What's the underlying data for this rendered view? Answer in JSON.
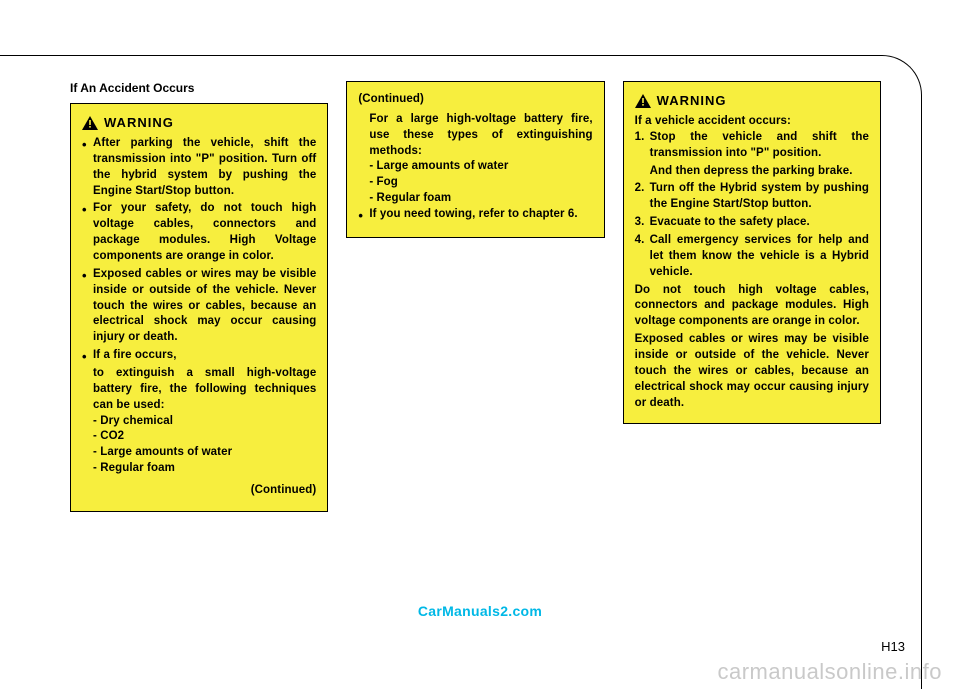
{
  "section_heading": "If An Accident Occurs",
  "warning_label": "WARNING",
  "col1": {
    "bullets": [
      "After parking the vehicle, shift the transmission into \"P\" position. Turn off the hybrid system by pushing the Engine Start/Stop button.",
      "For your safety, do not touch high voltage cables, connectors and package modules. High Voltage components are orange in color.",
      "Exposed cables or wires may be visible inside or outside of the vehicle. Never touch the wires or cables, because an electrical shock may occur causing injury or death.",
      "If a fire occurs,"
    ],
    "fire_text": "to extinguish a small high-voltage battery fire, the following techniques can be used:",
    "methods": [
      "- Dry chemical",
      "- CO2",
      "- Large amounts of water",
      "- Regular foam"
    ],
    "continued": "(Continued)"
  },
  "col2": {
    "continued": "(Continued)",
    "intro": "For a large high-voltage battery fire, use these types of extinguishing methods:",
    "methods": [
      "- Large amounts of water",
      "- Fog",
      "- Regular foam"
    ],
    "towing": "If you need towing, refer to chapter 6."
  },
  "col3": {
    "intro": "If a vehicle accident occurs:",
    "steps": [
      {
        "num": "1.",
        "text": "Stop the vehicle and shift the transmission into \"P\" position.",
        "extra": "And then depress the parking brake."
      },
      {
        "num": "2.",
        "text": "Turn off the Hybrid system by pushing the Engine Start/Stop button."
      },
      {
        "num": "3.",
        "text": "Evacuate to the safety place."
      },
      {
        "num": "4.",
        "text": "Call emergency services for help and let them know the vehicle is a Hybrid vehicle."
      }
    ],
    "para1": "Do not touch high voltage cables, connectors and package modules. High voltage components are orange in color.",
    "para2": "Exposed cables or wires may be visible inside or outside of the vehicle. Never touch the wires or cables, because an electrical shock may occur causing injury or death."
  },
  "watermark1": "CarManuals2.com",
  "page_number": "H13",
  "watermark2": "carmanualsonline.info"
}
